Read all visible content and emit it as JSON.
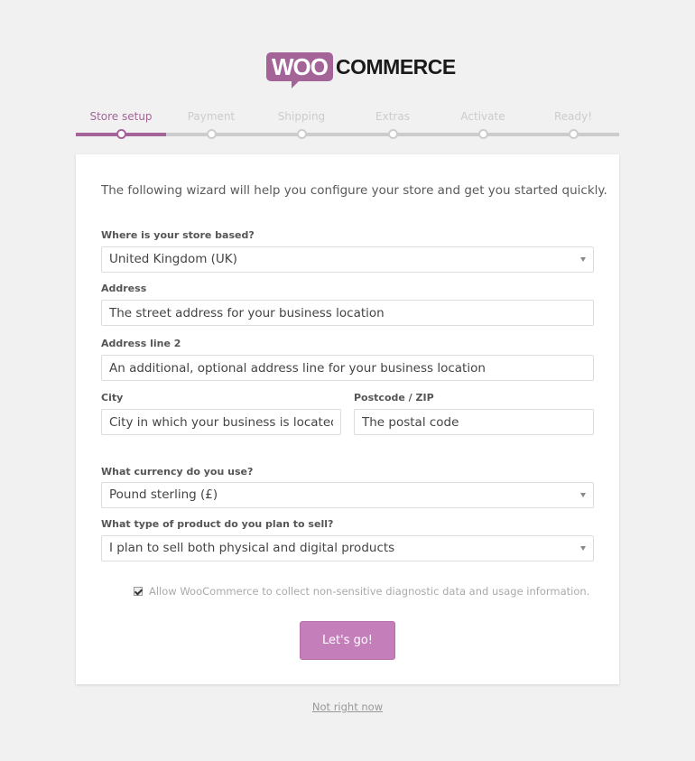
{
  "logo": {
    "part1": "WOO",
    "part2": "COMMERCE"
  },
  "colors": {
    "accent": "#a46497",
    "button": "#c47fba",
    "background": "#f1f1f1"
  },
  "steps": [
    {
      "label": "Store setup",
      "active": true
    },
    {
      "label": "Payment",
      "active": false
    },
    {
      "label": "Shipping",
      "active": false
    },
    {
      "label": "Extras",
      "active": false
    },
    {
      "label": "Activate",
      "active": false
    },
    {
      "label": "Ready!",
      "active": false
    }
  ],
  "form": {
    "intro": "The following wizard will help you configure your store and get you started quickly.",
    "country": {
      "label": "Where is your store based?",
      "value": "United Kingdom (UK)"
    },
    "address": {
      "label": "Address",
      "placeholder": "The street address for your business location"
    },
    "address2": {
      "label": "Address line 2",
      "placeholder": "An additional, optional address line for your business location"
    },
    "city": {
      "label": "City",
      "placeholder": "City in which your business is located"
    },
    "postcode": {
      "label": "Postcode / ZIP",
      "placeholder": "The postal code"
    },
    "currency": {
      "label": "What currency do you use?",
      "value": "Pound sterling (£)"
    },
    "product_type": {
      "label": "What type of product do you plan to sell?",
      "value": "I plan to sell both physical and digital products"
    },
    "tracking": {
      "label": "Allow WooCommerce to collect non-sensitive diagnostic data and usage information.",
      "checked": true
    },
    "submit_label": "Let's go!"
  },
  "skip_label": "Not right now"
}
